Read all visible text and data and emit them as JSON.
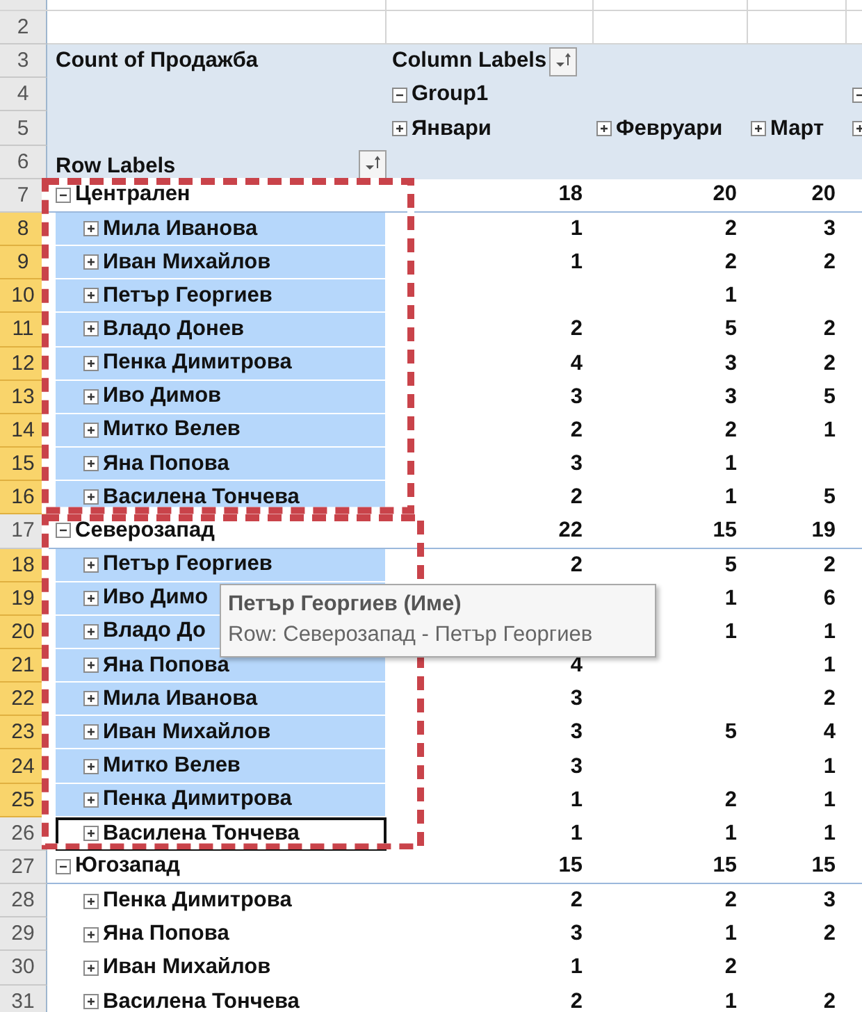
{
  "pivot": {
    "value_field": "Count of Продажба",
    "column_labels": "Column Labels",
    "row_labels": "Row Labels",
    "group": {
      "name": "Group1",
      "expanded": true
    },
    "months": [
      {
        "name": "Январи",
        "expanded": false
      },
      {
        "name": "Февруари",
        "expanded": false
      },
      {
        "name": "Март",
        "expanded": false
      }
    ],
    "next_column": {
      "group_expanded": true,
      "month_expanded": false
    },
    "regions": [
      {
        "name": "Централен",
        "expanded": true,
        "outlined": true,
        "totals": [
          "18",
          "20",
          "20"
        ],
        "rows": [
          {
            "name": "Мила Иванова",
            "expanded": false,
            "selected": true,
            "active": false,
            "values": {
              "month_1": "1",
              "month_2": "2",
              "month_3": "3"
            }
          },
          {
            "name": "Иван Михайлов",
            "expanded": false,
            "selected": true,
            "active": false,
            "values": {
              "month_1": "1",
              "month_2": "2",
              "month_3": "2"
            }
          },
          {
            "name": "Петър Георгиев",
            "expanded": false,
            "selected": true,
            "active": false,
            "values": {
              "month_2": "1"
            }
          },
          {
            "name": "Владо Донев",
            "expanded": false,
            "selected": true,
            "active": false,
            "values": {
              "month_1": "2",
              "month_2": "5",
              "month_3": "2"
            }
          },
          {
            "name": "Пенка Димитрова",
            "expanded": false,
            "selected": true,
            "active": false,
            "values": {
              "month_1": "4",
              "month_2": "3",
              "month_3": "2"
            }
          },
          {
            "name": "Иво Димов",
            "expanded": false,
            "selected": true,
            "active": false,
            "values": {
              "month_1": "3",
              "month_2": "3",
              "month_3": "5"
            }
          },
          {
            "name": "Митко Велев",
            "expanded": false,
            "selected": true,
            "active": false,
            "values": {
              "month_1": "2",
              "month_2": "2",
              "month_3": "1"
            }
          },
          {
            "name": "Яна Попова",
            "expanded": false,
            "selected": true,
            "active": false,
            "values": {
              "month_1": "3",
              "month_2": "1"
            }
          },
          {
            "name": "Василена Тончева",
            "expanded": false,
            "selected": true,
            "active": false,
            "values": {
              "month_1": "2",
              "month_2": "1",
              "month_3": "5"
            }
          }
        ]
      },
      {
        "name": "Северозапад",
        "expanded": true,
        "outlined": true,
        "totals": [
          "22",
          "15",
          "19"
        ],
        "rows": [
          {
            "name": "Петър Георгиев",
            "expanded": false,
            "selected": true,
            "active": false,
            "values": {
              "month_1": "2",
              "month_2": "5",
              "month_3": "2"
            }
          },
          {
            "name": "Иво Димо",
            "expanded": false,
            "selected": true,
            "active": false,
            "values": {
              "month_2": "1",
              "month_3": "6"
            }
          },
          {
            "name": "Владо До",
            "expanded": false,
            "selected": true,
            "active": false,
            "values": {
              "month_2": "1",
              "month_3": "1"
            }
          },
          {
            "name": "Яна Попова",
            "expanded": false,
            "selected": true,
            "active": false,
            "values": {
              "month_1": "4",
              "month_3": "1"
            }
          },
          {
            "name": "Мила Иванова",
            "expanded": false,
            "selected": true,
            "active": false,
            "values": {
              "month_1": "3",
              "month_3": "2"
            }
          },
          {
            "name": "Иван Михайлов",
            "expanded": false,
            "selected": true,
            "active": false,
            "values": {
              "month_1": "3",
              "month_2": "5",
              "month_3": "4"
            }
          },
          {
            "name": "Митко Велев",
            "expanded": false,
            "selected": true,
            "active": false,
            "values": {
              "month_1": "3",
              "month_3": "1"
            }
          },
          {
            "name": "Пенка Димитрова",
            "expanded": false,
            "selected": true,
            "active": false,
            "values": {
              "month_1": "1",
              "month_2": "2",
              "month_3": "1"
            }
          },
          {
            "name": "Василена Тончева",
            "expanded": false,
            "selected": false,
            "active": true,
            "values": {
              "month_1": "1",
              "month_2": "1",
              "month_3": "1"
            }
          }
        ]
      },
      {
        "name": "Югозапад",
        "expanded": true,
        "outlined": false,
        "totals": [
          "15",
          "15",
          "15"
        ],
        "rows": [
          {
            "name": "Пенка Димитрова",
            "expanded": false,
            "selected": false,
            "active": false,
            "values": {
              "month_1": "2",
              "month_2": "2",
              "month_3": "3"
            }
          },
          {
            "name": "Яна Попова",
            "expanded": false,
            "selected": false,
            "active": false,
            "values": {
              "month_1": "3",
              "month_2": "1",
              "month_3": "2"
            }
          },
          {
            "name": "Иван Михайлов",
            "expanded": false,
            "selected": false,
            "active": false,
            "values": {
              "month_1": "1",
              "month_2": "2"
            }
          },
          {
            "name": "Василена Тончева",
            "expanded": false,
            "selected": false,
            "active": false,
            "values": {
              "month_1": "2",
              "month_2": "1",
              "month_3": "2"
            }
          }
        ]
      }
    ]
  },
  "row_numbers": [
    "2",
    "3",
    "4",
    "5",
    "6",
    "7",
    "8",
    "9",
    "10",
    "11",
    "12",
    "13",
    "14",
    "15",
    "16",
    "17",
    "18",
    "19",
    "20",
    "21",
    "22",
    "23",
    "24",
    "25",
    "26",
    "27",
    "28",
    "29",
    "30",
    "31"
  ],
  "tooltip": {
    "title": "Петър Георгиев (Име)",
    "detail": "Row: Северозапад - Петър Георгиев"
  }
}
